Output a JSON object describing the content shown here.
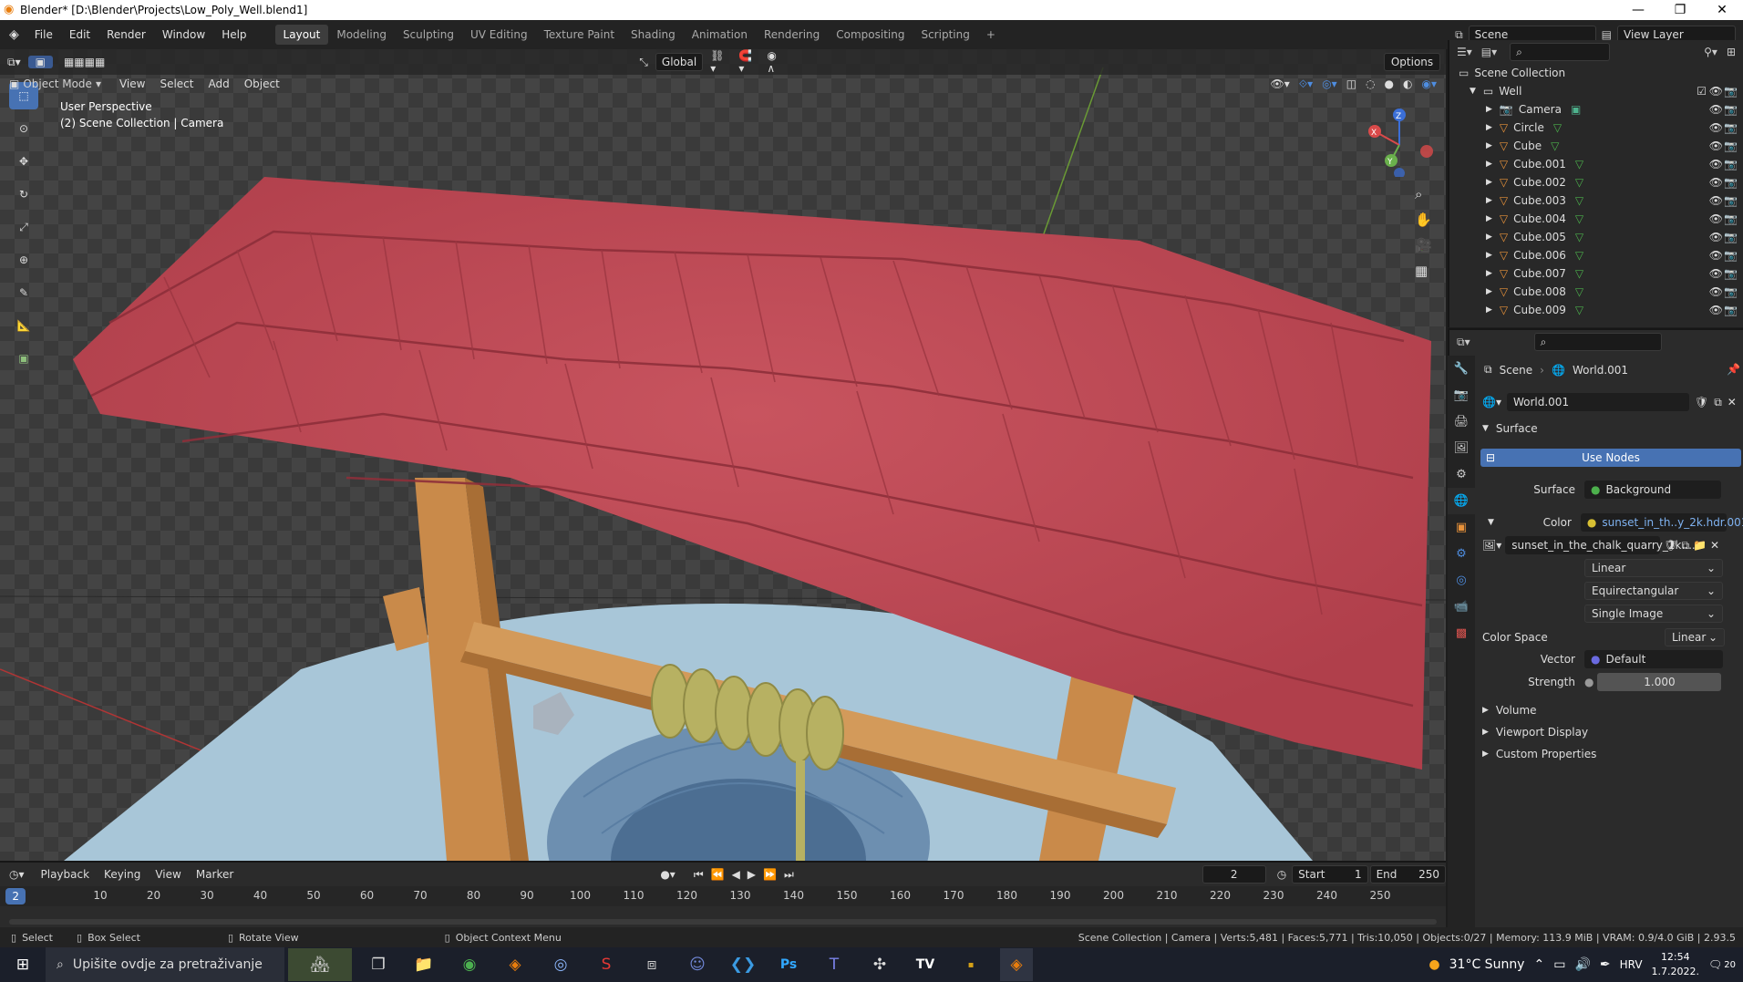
{
  "window": {
    "title": "Blender* [D:\\Blender\\Projects\\Low_Poly_Well.blend1]",
    "minimize": "—",
    "restore": "❐",
    "close": "✕"
  },
  "menu": {
    "items": [
      "File",
      "Edit",
      "Render",
      "Window",
      "Help"
    ]
  },
  "workspaces": [
    "Layout",
    "Modeling",
    "Sculpting",
    "UV Editing",
    "Texture Paint",
    "Shading",
    "Animation",
    "Rendering",
    "Compositing",
    "Scripting"
  ],
  "scene": {
    "label": "Scene",
    "view_layer": "View Layer"
  },
  "viewport": {
    "mode": "Object Mode",
    "menus": [
      "View",
      "Select",
      "Add",
      "Object"
    ],
    "orientation": "Global",
    "options": "Options",
    "overlay_title": "User Perspective",
    "overlay_sub": "(2) Scene Collection | Camera",
    "gizmo": {
      "x": "X",
      "y": "Y",
      "z": "Z"
    }
  },
  "outliner": {
    "root": "Scene Collection",
    "collection": "Well",
    "items": [
      "Camera",
      "Circle",
      "Cube",
      "Cube.001",
      "Cube.002",
      "Cube.003",
      "Cube.004",
      "Cube.005",
      "Cube.006",
      "Cube.007",
      "Cube.008",
      "Cube.009"
    ]
  },
  "properties": {
    "breadcrumb_scene": "Scene",
    "breadcrumb_world": "World.001",
    "world_name": "World.001",
    "surface_header": "Surface",
    "use_nodes": "Use Nodes",
    "surface_label": "Surface",
    "surface_value": "Background",
    "color_label": "Color",
    "color_value": "sunset_in_th..y_2k.hdr.001",
    "image_name": "sunset_in_the_chalk_quarry_2k....",
    "interp": "Linear",
    "projection": "Equirectangular",
    "source": "Single Image",
    "color_space_label": "Color Space",
    "color_space_value": "Linear",
    "vector_label": "Vector",
    "vector_value": "Default",
    "strength_label": "Strength",
    "strength_value": "1.000",
    "panels": [
      "Volume",
      "Viewport Display",
      "Custom Properties"
    ]
  },
  "timeline": {
    "menus": [
      "Playback",
      "Keying",
      "View",
      "Marker"
    ],
    "current_frame": "2",
    "start_label": "Start",
    "start": "1",
    "end_label": "End",
    "end": "250",
    "ticks": [
      "10",
      "20",
      "30",
      "40",
      "50",
      "60",
      "70",
      "80",
      "90",
      "100",
      "110",
      "120",
      "130",
      "140",
      "150",
      "160",
      "170",
      "180",
      "190",
      "200",
      "210",
      "220",
      "230",
      "240",
      "250"
    ]
  },
  "status": {
    "select": "Select",
    "box_select": "Box Select",
    "rotate": "Rotate View",
    "context": "Object Context Menu",
    "stats": "Scene Collection | Camera | Verts:5,481 | Faces:5,771 | Tris:10,050 | Objects:0/27 | Memory: 113.9 MiB | VRAM: 0.9/4.0 GiB | 2.93.5"
  },
  "taskbar": {
    "search_placeholder": "Upišite ovdje za pretraživanje",
    "weather": "31°C  Sunny",
    "lang": "HRV",
    "time": "12:54",
    "date": "1.7.2022.",
    "notif": "20"
  },
  "colors": {
    "accent": "#4772b3",
    "roof": "#b8434f",
    "wood": "#c98a4a",
    "ground": "#a8c6d8"
  }
}
